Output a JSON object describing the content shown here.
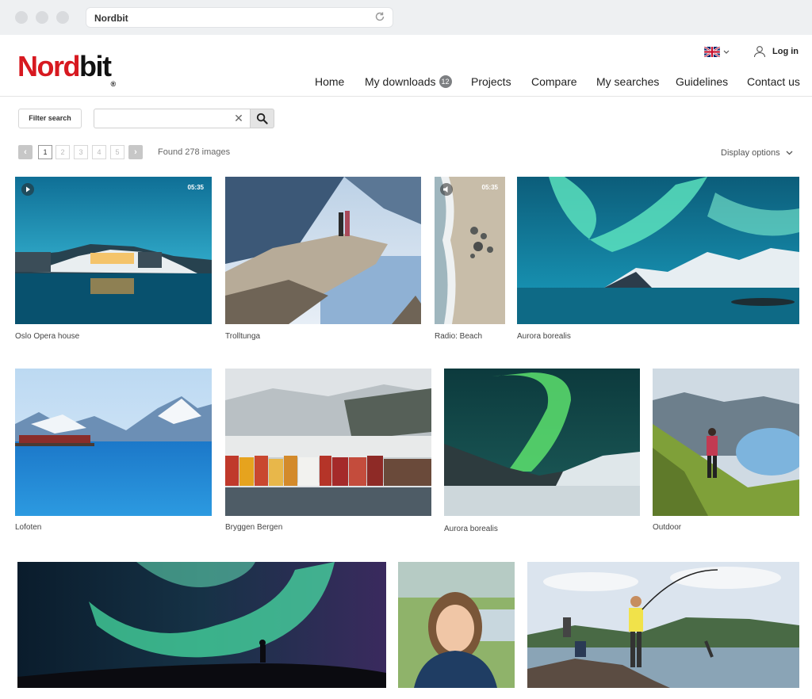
{
  "browser": {
    "url": "Nordbit"
  },
  "brand": {
    "logo_red": "Nord",
    "logo_black": "bit",
    "logo_mark": "®",
    "accent": "#d71920"
  },
  "header": {
    "language_icon": "uk-flag-icon",
    "login_label": "Log in",
    "nav": [
      {
        "label": "Home"
      },
      {
        "label": "My downloads",
        "badge": "12"
      },
      {
        "label": "Projects"
      },
      {
        "label": "Compare"
      },
      {
        "label": "My searches"
      },
      {
        "label": "Guidelines"
      },
      {
        "label": "Contact us"
      }
    ]
  },
  "toolbar": {
    "filter_label": "Filter search",
    "search_value": "",
    "search_placeholder": ""
  },
  "pager": {
    "prev_icon": "‹",
    "next_icon": "›",
    "pages": [
      "1",
      "2",
      "3",
      "4",
      "5"
    ],
    "current_page": "1",
    "found_text": "Found 278 images",
    "display_options_label": "Display options"
  },
  "gallery": [
    {
      "caption": "Oslo Opera house",
      "duration": "05:35",
      "media": "play-icon"
    },
    {
      "caption": "Trolltunga"
    },
    {
      "caption": "Radio: Beach",
      "duration": "05:35",
      "media": "audio-icon"
    },
    {
      "caption": "Aurora borealis"
    },
    {
      "caption": "Lofoten"
    },
    {
      "caption": "Bryggen Bergen"
    },
    {
      "caption": "Aurora borealis"
    },
    {
      "caption": "Outdoor"
    },
    {
      "caption": ""
    },
    {
      "caption": ""
    },
    {
      "caption": ""
    }
  ]
}
